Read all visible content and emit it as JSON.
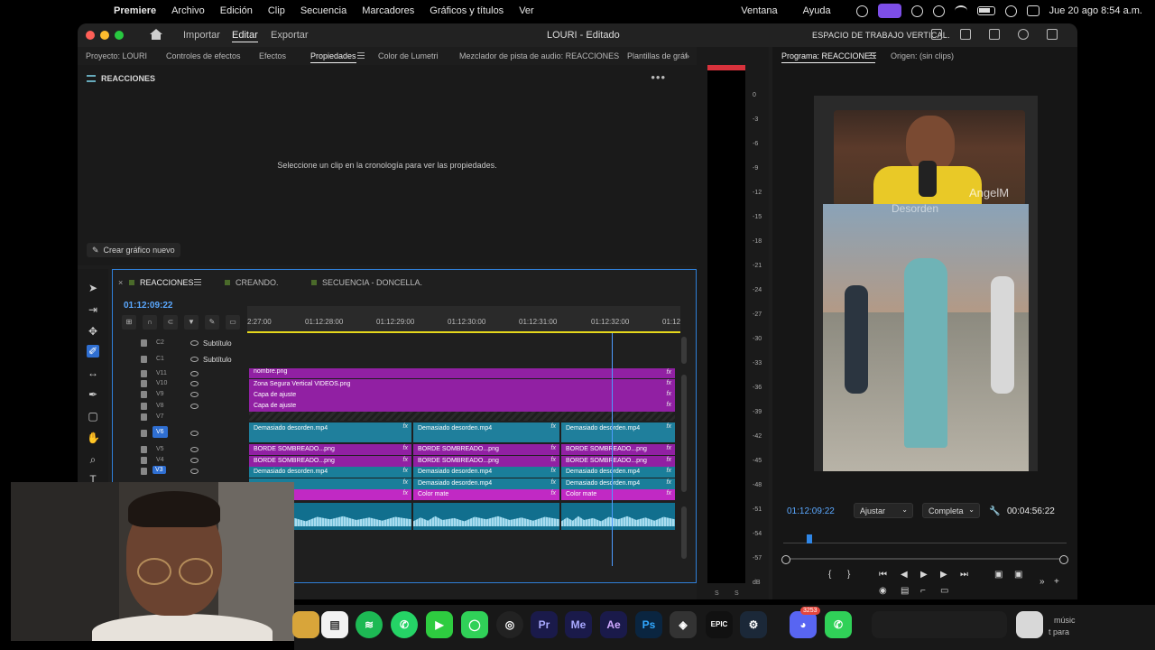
{
  "menubar": {
    "app": "Premiere",
    "items": [
      "Archivo",
      "Edición",
      "Clip",
      "Secuencia",
      "Marcadores",
      "Gráficos y títulos",
      "Ver"
    ],
    "right_items": [
      "Ventana",
      "Ayuda"
    ],
    "clock": "Jue 20 ago 8:54 a.m."
  },
  "window": {
    "modes": [
      "Importar",
      "Editar",
      "Exportar"
    ],
    "active_mode": "Editar",
    "title": "LOURI - Editado",
    "workspace": "ESPACIO DE TRABAJO VERTICAL."
  },
  "panel_tabs": [
    "Proyecto: LOURI",
    "Controles de efectos",
    "Efectos",
    "Propiedades",
    "Color de Lumetri",
    "Mezclador de pista de audio: REACCIONES",
    "Plantillas de gráf"
  ],
  "properties": {
    "header": "REACCIONES",
    "message": "Seleccione un clip en la cronología para ver las propiedades.",
    "new_graphic": "Crear gráfico nuevo"
  },
  "meter": {
    "ticks": [
      "0",
      "-3",
      "-6",
      "-9",
      "-12",
      "-15",
      "-18",
      "-21",
      "-24",
      "-27",
      "-30",
      "-33",
      "-36",
      "-39",
      "-42",
      "-45",
      "-48",
      "-51",
      "-54",
      "-57",
      "dB"
    ],
    "footer": [
      "S",
      "S"
    ]
  },
  "program": {
    "tab_program": "Programa: REACCIONES",
    "tab_source": "Origen: (sin clips)",
    "timecode": "01:12:09:22",
    "fit": "Ajustar",
    "quality": "Completa",
    "duration": "00:04:56:22",
    "watermark1": "AngelM",
    "watermark2": "Desorden"
  },
  "timeline": {
    "tabs": [
      "REACCIONES",
      "CREANDO.",
      "SECUENCIA - DONCELLA."
    ],
    "timecode": "01:12:09:22",
    "ruler": [
      "2:27:00",
      "01:12:28:00",
      "01:12:29:00",
      "01:12:30:00",
      "01:12:31:00",
      "01:12:32:00",
      "01:12"
    ],
    "tracks": {
      "c2": {
        "id": "C2",
        "label": "Subtítulo"
      },
      "c1": {
        "id": "C1",
        "label": "Subtítulo"
      },
      "v11": "V11",
      "v10": "V10",
      "v9": "V9",
      "v8": "V8",
      "v7": "V7",
      "v6": "V6",
      "v5": "V5",
      "v4": "V4",
      "v3": "V3"
    },
    "clips": {
      "nombre": "nombre.png",
      "zona": "Zona Segura Vertical VIDEOS.png",
      "ajuste1": "Capa de ajuste",
      "ajuste2": "Capa de ajuste",
      "desorden": "Demasiado desorden.mp4",
      "borde": "BORDE SOMBREADO...png",
      "color_mate": "Color mate",
      "fx": "fx"
    }
  },
  "dock": {
    "badge": "3253",
    "note1": "músic",
    "note2": "t para"
  }
}
